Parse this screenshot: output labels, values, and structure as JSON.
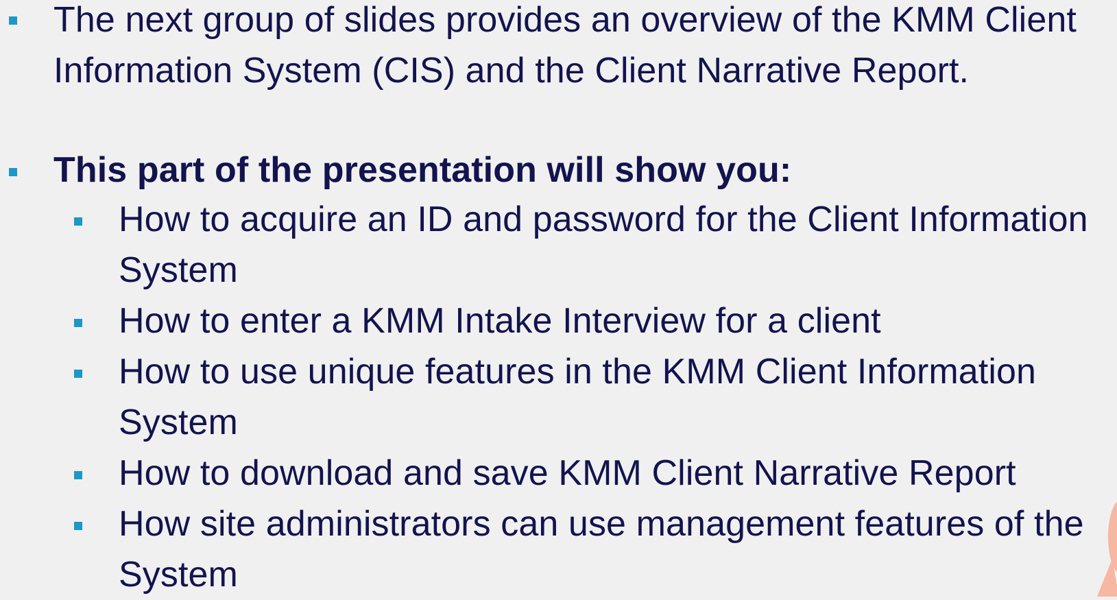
{
  "slide": {
    "bullets": [
      {
        "lines": [
          "The next group of slides provides an overview of the KMM Client",
          "Information System (CIS) and the Client Narrative Report."
        ]
      },
      {
        "heading": "This part of the presentation will show you:",
        "items": [
          {
            "lines": [
              "How to acquire an ID and password for the Client Information",
              "System"
            ]
          },
          {
            "lines": [
              "How to enter a KMM Intake Interview for a client"
            ]
          },
          {
            "lines": [
              "How to use unique features in the KMM Client Information",
              "System"
            ]
          },
          {
            "lines": [
              "How to download and save KMM Client Narrative Report"
            ]
          },
          {
            "lines": [
              "How site administrators can use management features of the",
              "System"
            ]
          }
        ]
      }
    ]
  },
  "colors": {
    "background": "#f0f0f0",
    "text": "#13134e",
    "bullet": "#1b98c6",
    "accent_shape": "#f6b7a3"
  }
}
